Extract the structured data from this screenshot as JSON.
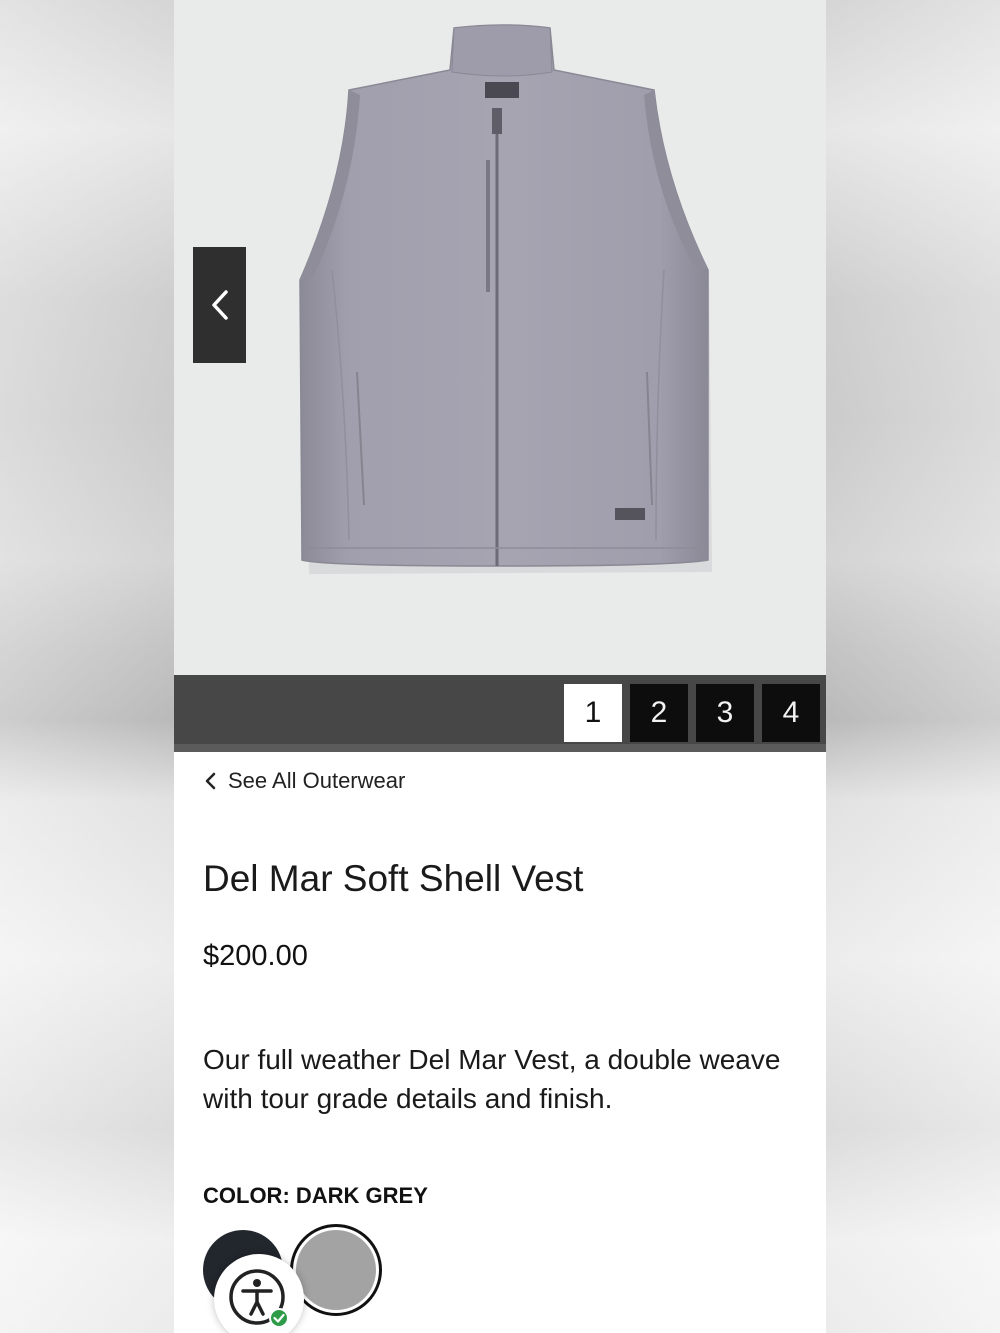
{
  "gallery": {
    "prev_label": "<",
    "pages": [
      "1",
      "2",
      "3",
      "4"
    ],
    "active_page": "1"
  },
  "breadcrumb": {
    "back_label": "See All Outerwear"
  },
  "product": {
    "title": "Del Mar Soft Shell Vest",
    "price": "$200.00",
    "description": "Our full weather Del Mar Vest, a double weave with tour grade details and finish.",
    "color_label": "COLOR: DARK GREY",
    "swatches": [
      {
        "name": "navy",
        "color": "#22262d",
        "selected": false
      },
      {
        "name": "dark-grey",
        "color": "#a3a3a3",
        "selected": true
      }
    ]
  },
  "accessibility": {
    "icon": "accessibility-icon",
    "status_icon": "check-badge-icon",
    "status_color": "#2e9b48"
  }
}
